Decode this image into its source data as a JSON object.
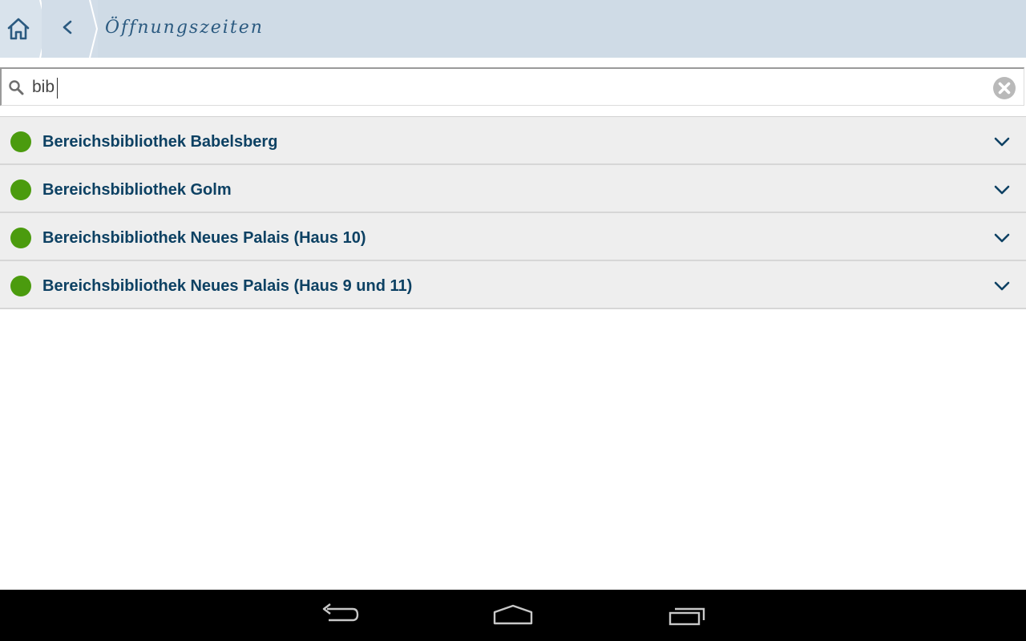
{
  "header": {
    "title": "Öffnungszeiten",
    "home_icon": "home-icon",
    "back_icon": "chevron-left-icon",
    "background": "#cfdbe6",
    "title_color": "#2b5a80"
  },
  "search": {
    "value": "bib",
    "placeholder": "",
    "search_icon": "search-icon",
    "clear_icon": "clear-icon"
  },
  "list": {
    "items": [
      {
        "label": "Bereichsbibliothek Babelsberg",
        "status": "open",
        "status_color": "#4b9b0e",
        "icon": "chevron-down-icon"
      },
      {
        "label": "Bereichsbibliothek Golm",
        "status": "open",
        "status_color": "#4b9b0e",
        "icon": "chevron-down-icon"
      },
      {
        "label": "Bereichsbibliothek Neues Palais (Haus 10)",
        "status": "open",
        "status_color": "#4b9b0e",
        "icon": "chevron-down-icon"
      },
      {
        "label": "Bereichsbibliothek Neues Palais (Haus 9 und 11)",
        "status": "open",
        "status_color": "#4b9b0e",
        "icon": "chevron-down-icon"
      }
    ],
    "label_color": "#0d4163",
    "row_background": "#eeeeee"
  },
  "system_nav": {
    "buttons": [
      "back-icon",
      "home-icon",
      "recent-apps-icon"
    ]
  }
}
